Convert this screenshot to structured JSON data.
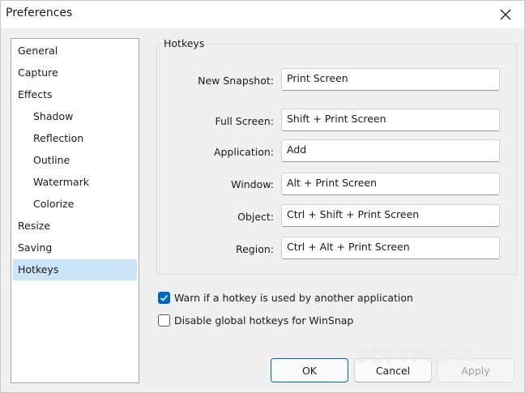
{
  "window": {
    "title": "Preferences"
  },
  "nav": {
    "items": [
      {
        "label": "General",
        "child": false,
        "selected": false
      },
      {
        "label": "Capture",
        "child": false,
        "selected": false
      },
      {
        "label": "Effects",
        "child": false,
        "selected": false
      },
      {
        "label": "Shadow",
        "child": true,
        "selected": false
      },
      {
        "label": "Reflection",
        "child": true,
        "selected": false
      },
      {
        "label": "Outline",
        "child": true,
        "selected": false
      },
      {
        "label": "Watermark",
        "child": true,
        "selected": false
      },
      {
        "label": "Colorize",
        "child": true,
        "selected": false
      },
      {
        "label": "Resize",
        "child": false,
        "selected": false
      },
      {
        "label": "Saving",
        "child": false,
        "selected": false
      },
      {
        "label": "Hotkeys",
        "child": false,
        "selected": true
      }
    ]
  },
  "hotkeys": {
    "group_title": "Hotkeys",
    "rows": [
      {
        "label": "New Snapshot:",
        "value": "Print Screen"
      },
      {
        "label": "Full Screen:",
        "value": "Shift + Print Screen"
      },
      {
        "label": "Application:",
        "value": "Add"
      },
      {
        "label": "Window:",
        "value": "Alt + Print Screen"
      },
      {
        "label": "Object:",
        "value": "Ctrl + Shift + Print Screen"
      },
      {
        "label": "Region:",
        "value": "Ctrl + Alt + Print Screen"
      }
    ]
  },
  "options": {
    "warn_label": "Warn if a hotkey is used by another application",
    "warn_checked": true,
    "disable_label": "Disable global hotkeys for WinSnap",
    "disable_checked": false
  },
  "buttons": {
    "ok": "OK",
    "cancel": "Cancel",
    "apply": "Apply"
  },
  "watermark": "SOFTPEDIA",
  "colors": {
    "accent": "#0067c0",
    "selection": "#cce4f7"
  }
}
